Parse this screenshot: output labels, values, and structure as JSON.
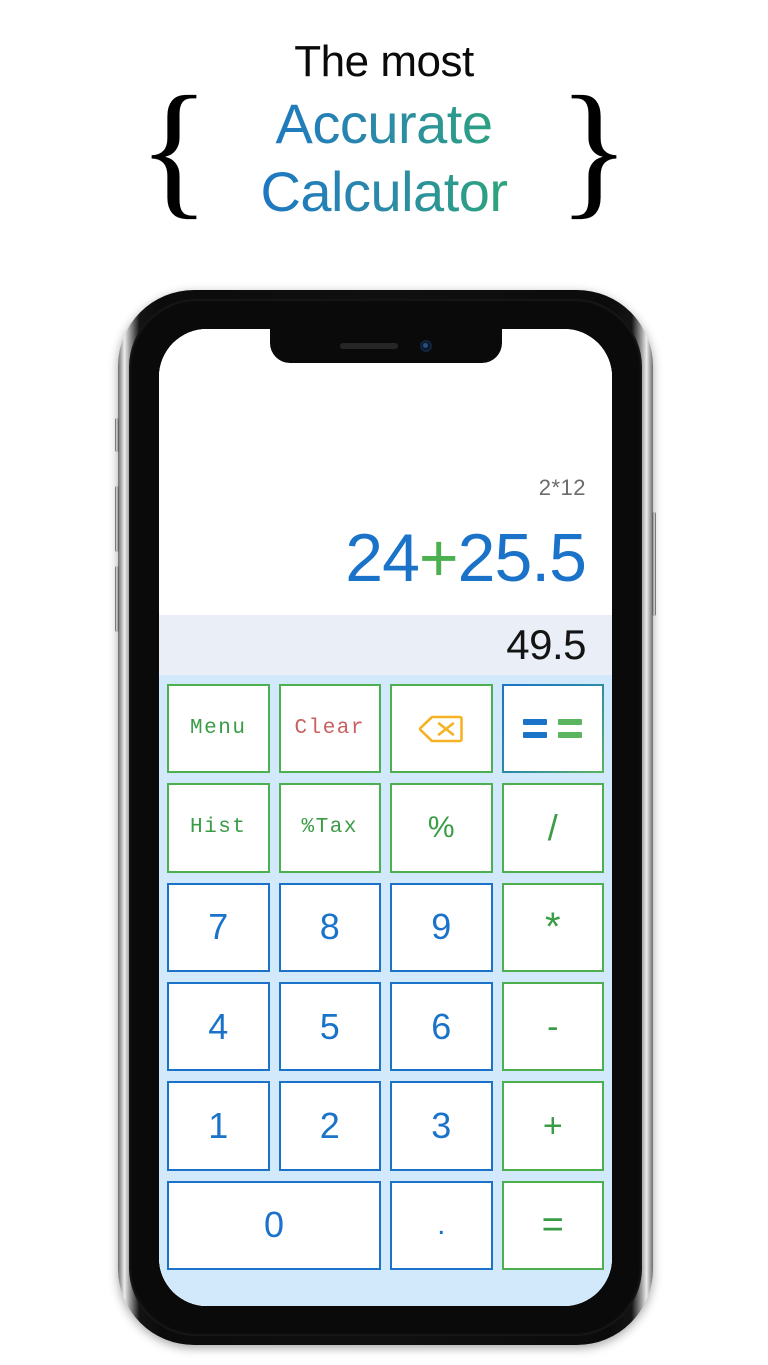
{
  "headline": {
    "tagline": "The most",
    "brand_line1": "Accurate",
    "brand_line2": "Calculator",
    "brace_left": "{",
    "brace_right": "}",
    "gradient_start": "#1a73c8",
    "gradient_end": "#2eaa72",
    "tagline_color": "#0a0a0a"
  },
  "calculator": {
    "display": {
      "history": "2*12",
      "expression_left": "24",
      "expression_operator": "+",
      "expression_right": "25.5",
      "result": "49.5",
      "expression_color": "#1a73c8",
      "operator_color": "#4caf50",
      "result_color": "#141414",
      "result_band_color": "#eaeff7",
      "history_color": "#6b6b6b"
    },
    "keypad": {
      "background_color": "#d2e9fb",
      "number_color": "#1a73c8",
      "operator_color": "#3a9c45",
      "clear_color": "#c9605f",
      "backspace_color": "#f5b323",
      "keys": [
        {
          "label": "Menu",
          "name": "menu",
          "type": "word"
        },
        {
          "label": "Clear",
          "name": "clear",
          "type": "word-clear"
        },
        {
          "label": "",
          "name": "backspace",
          "type": "backspace"
        },
        {
          "label": "==",
          "name": "double-equals",
          "type": "eqeq"
        },
        {
          "label": "Hist",
          "name": "history",
          "type": "word"
        },
        {
          "label": "%Tax",
          "name": "percent-tax",
          "type": "word"
        },
        {
          "label": "%",
          "name": "percent",
          "type": "op-pct"
        },
        {
          "label": "/",
          "name": "divide",
          "type": "op-slash"
        },
        {
          "label": "7",
          "name": "seven",
          "type": "num"
        },
        {
          "label": "8",
          "name": "eight",
          "type": "num"
        },
        {
          "label": "9",
          "name": "nine",
          "type": "num"
        },
        {
          "label": "*",
          "name": "multiply",
          "type": "op-mul"
        },
        {
          "label": "4",
          "name": "four",
          "type": "num"
        },
        {
          "label": "5",
          "name": "five",
          "type": "num"
        },
        {
          "label": "6",
          "name": "six",
          "type": "num"
        },
        {
          "label": "-",
          "name": "subtract",
          "type": "op-minus"
        },
        {
          "label": "1",
          "name": "one",
          "type": "num"
        },
        {
          "label": "2",
          "name": "two",
          "type": "num"
        },
        {
          "label": "3",
          "name": "three",
          "type": "num"
        },
        {
          "label": "+",
          "name": "add",
          "type": "op-plus"
        },
        {
          "label": "0",
          "name": "zero",
          "type": "num-wide"
        },
        {
          "label": ".",
          "name": "decimal-point",
          "type": "num-dot"
        },
        {
          "label": "=",
          "name": "equals",
          "type": "op-equal"
        }
      ]
    }
  },
  "device": {
    "type": "smartphone-notch",
    "frame_color": "#0a0a0a"
  }
}
